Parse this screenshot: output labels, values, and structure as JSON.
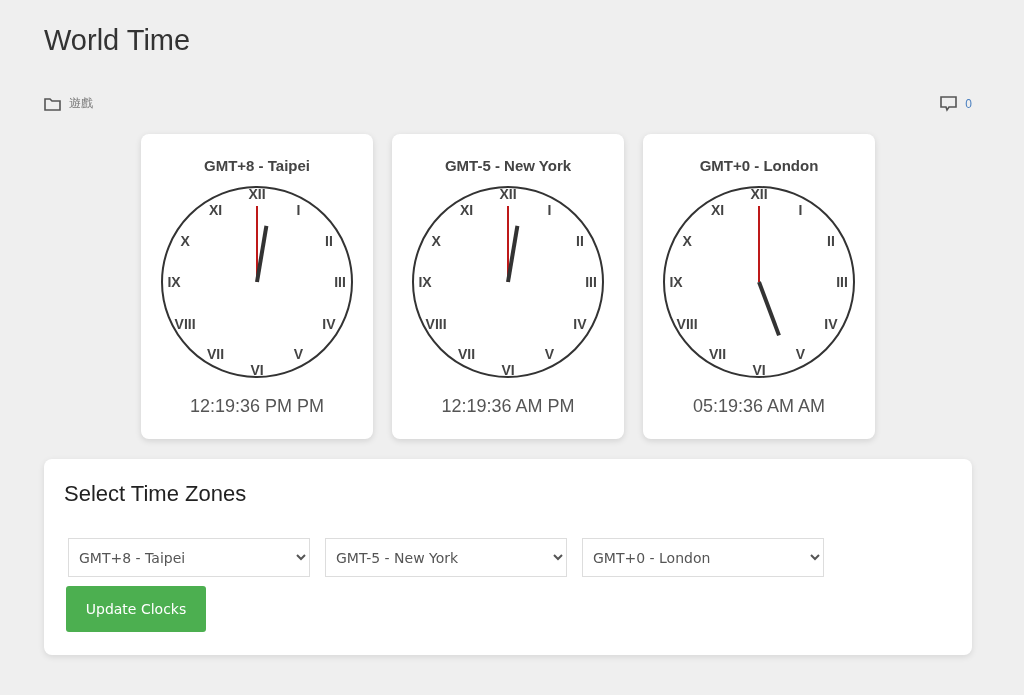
{
  "page_title": "World Time",
  "category": "遊戲",
  "comment_count": "0",
  "clocks": [
    {
      "title": "GMT+8 - Taipei",
      "numerals": [
        "XII",
        "I",
        "II",
        "III",
        "IV",
        "V",
        "VI",
        "VII",
        "VIII",
        "IX",
        "X",
        "XI"
      ],
      "time": "12:19:36 PM PM"
    },
    {
      "title": "GMT-5 - New York",
      "numerals": [
        "XII",
        "I",
        "II",
        "III",
        "IV",
        "V",
        "VI",
        "VII",
        "VIII",
        "IX",
        "X",
        "XI"
      ],
      "time": "12:19:36 AM PM"
    },
    {
      "title": "GMT+0 - London",
      "numerals": [
        "XII",
        "I",
        "II",
        "III",
        "IV",
        "V",
        "VI",
        "VII",
        "VIII",
        "IX",
        "X",
        "XI"
      ],
      "time": "05:19:36 AM AM"
    }
  ],
  "panel": {
    "title": "Select Time Zones",
    "selects": [
      "GMT+8 - Taipei",
      "GMT-5 - New York",
      "GMT+0 - London"
    ],
    "button": "Update Clocks"
  }
}
